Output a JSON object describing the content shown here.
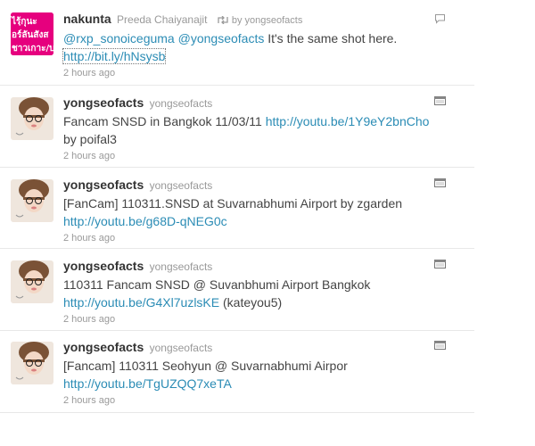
{
  "tweets": [
    {
      "screen_name": "nakunta",
      "full_name": "Preeda Chaiyanajit",
      "retweet_text": "by yongseofacts",
      "mention1": "@rxp_sonoiceguma",
      "mention2": "@yongseofacts",
      "text_after": " It's the same shot here.",
      "link": "http://bit.ly/hNsysb",
      "time": "2 hours ago",
      "avatar_text": [
        "ไรฺ้กุนะ",
        "อร์ลันสังส",
        "ชาวเกาะ/บ"
      ],
      "avatar_color": "#e6007e"
    },
    {
      "screen_name": "yongseofacts",
      "full_name": "yongseofacts",
      "text_before": "Fancam SNSD in Bangkok 11/03/11 ",
      "link": "http://youtu.be/1Y9eY2bnCho",
      "text_after": "by poifal3",
      "time": "2 hours ago"
    },
    {
      "screen_name": "yongseofacts",
      "full_name": "yongseofacts",
      "text_before": "[FanCam] 110311.SNSD at Suvarnabhumi Airport by zgarden",
      "link": "http://youtu.be/g68D-qNEG0c",
      "time": "2 hours ago"
    },
    {
      "screen_name": "yongseofacts",
      "full_name": "yongseofacts",
      "text_before": "110311 Fancam SNSD @ Suvanbhumi Airport Bangkok",
      "link": "http://youtu.be/G4Xl7uzlsKE",
      "text_after": " (kateyou5)",
      "time": "2 hours ago"
    },
    {
      "screen_name": "yongseofacts",
      "full_name": "yongseofacts",
      "text_before": "[Fancam] 110311 Seohyun @ Suvarnabhumi Airpor",
      "link": "http://youtu.be/TgUZQQ7xeTA",
      "time": "2 hours ago"
    }
  ],
  "colors": {
    "link": "#2b8cb5",
    "meta": "#999999",
    "divider": "#e8e8e8"
  },
  "icons": [
    "reply-icon",
    "retweet-icon",
    "media-icon"
  ]
}
